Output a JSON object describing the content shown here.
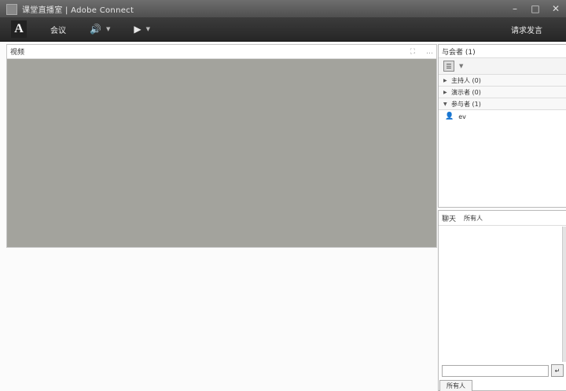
{
  "window": {
    "title": "课堂直播室 | Adobe Connect",
    "minimize_icon": "–",
    "maximize_icon": "□",
    "close_icon": "✕"
  },
  "menubar": {
    "logo_text": "A",
    "meeting_label": "会议",
    "audio_icon": "🔊",
    "camera_icon": "▶",
    "caret": "▼",
    "right_label": "请求发言"
  },
  "video_pod": {
    "title": "视频",
    "fullscreen_icon": "⛶",
    "menu_icon": "…"
  },
  "attendees": {
    "title": "与会者 (1)",
    "view_icon": "☰",
    "caret": "▼",
    "categories": [
      {
        "arrow": "▶",
        "label": "主持人 (0)"
      },
      {
        "arrow": "▶",
        "label": "演示者 (0)"
      },
      {
        "arrow": "▼",
        "label": "参与者 (1)"
      }
    ],
    "participants": [
      {
        "icon": "👤",
        "name": "ev"
      }
    ]
  },
  "chat": {
    "title": "聊天",
    "to_label": "所有人",
    "input_value": "",
    "send_icon": "↵",
    "tab_label": "所有人"
  }
}
